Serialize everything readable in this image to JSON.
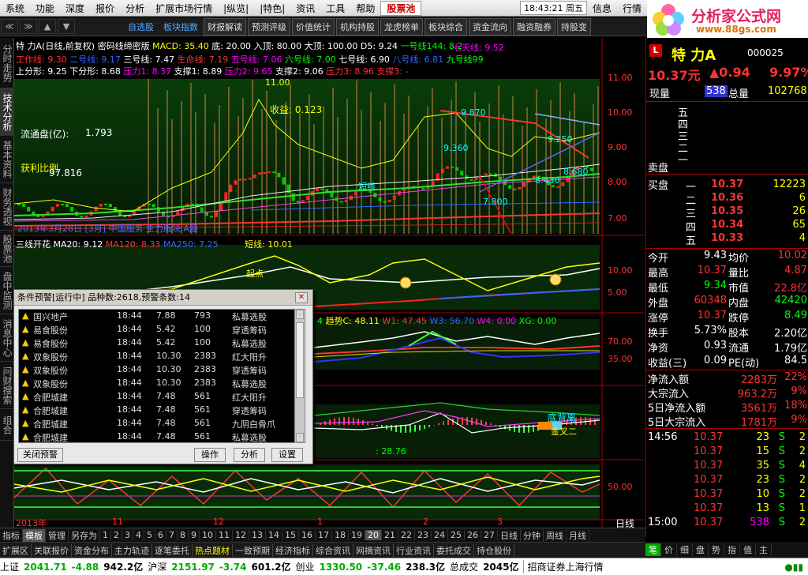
{
  "menubar": {
    "items": [
      "系统",
      "功能",
      "深度",
      "报价",
      "分析",
      "扩展市场行情",
      "|纵览|",
      "|特色|",
      "资讯",
      "工具",
      "帮助"
    ],
    "highlight": "股票池",
    "time": "18:43:21",
    "weekday": "周五",
    "right": [
      "信息",
      "行情"
    ]
  },
  "logo": {
    "title": "分析家公式网",
    "site": "www.88gs.com"
  },
  "toolbar": {
    "items": [
      "自选股",
      "板块指数",
      "财报解读",
      "预测评级",
      "价值统计",
      "机构持股",
      "龙虎榜单",
      "板块综合",
      "资金流向",
      "融资融券",
      "持股变"
    ]
  },
  "left_tabs": [
    "分时走势",
    "技术分析",
    "基本资料",
    "财务透视",
    "股票池",
    "盘中监测",
    "消息中心",
    "问财搜索",
    "组合"
  ],
  "main_info": {
    "stock": "特 力A(日线,前复权)",
    "formula": "密码线缔密版",
    "macd": "MACD: 35.40",
    "di": "底: 20.00",
    "ruding": "入顶: 80.00",
    "dading": "大顶: 100.00",
    "d5": "D5: 9.24",
    "yihao": "一号线144: 8.2",
    "line2": [
      "工作线: 9.30",
      "二号线: 9.17",
      "三号线: 7.47",
      "生命线: 7.19",
      "五号线: 7.06",
      "六号线: 7.00",
      "七号线: 6.90",
      "八号线: 6.81",
      "九号线99"
    ],
    "qitian": "七天线: 9.52",
    "line3": [
      "上分形: 9.25",
      "下分形: 8.68",
      "压力1: 8.37",
      "支撑1: 8.89",
      "压力2: 9.65",
      "支撑2: 9.06",
      "压力3: 8.96",
      "支撑3: -"
    ],
    "liutongpan": "流通盘(亿):",
    "liutong_val": "1.793",
    "huoli": "获利比例",
    "huoli_val": "97.816",
    "shouyi": "收益: 0.123",
    "price_labels": [
      "11.00",
      "10.00",
      "9.00",
      "8.00",
      "7.00"
    ],
    "annot": [
      "11.00",
      "9.870",
      "9.360",
      "9.250",
      "8.680",
      "8.430",
      "7.800",
      "短线"
    ],
    "ticker_line": "2013年3月28日 [3月] 中国服务 主力版块 A股",
    "sub1_label": "三线开花",
    "ma20": "MA20: 9.12",
    "ma120": "MA120: 8.33",
    "ma250": "MA250: 7.25",
    "duanxian": "短线: 10.01",
    "sub2_labels": [
      "10.00",
      "5.00"
    ],
    "qidian": "起点",
    "trend": "趋势C: 48.11",
    "w1": "W1: 47.45",
    "w3": "W3: 56.70",
    "w4": "W4: 0.00",
    "xg": "XG: 0.00",
    "sub3_labels": [
      "70.00",
      "35.00"
    ],
    "sub4_labels": [
      "底背离",
      "金叉二"
    ],
    "sub4_val": ": 28.76",
    "sub5_labels": [
      "50.00"
    ],
    "xaxis": [
      "2013年",
      "11",
      "12",
      "1",
      "2",
      "3"
    ],
    "dayline": "日线"
  },
  "dialog": {
    "title": "条件预警[运行中] 品种数:2618,预警条数:14",
    "rows": [
      [
        "国兴地产",
        "18:44",
        "7.88",
        "793",
        "私募选股"
      ],
      [
        "易食股份",
        "18:44",
        "5.42",
        "100",
        "穿透筹码"
      ],
      [
        "易食股份",
        "18:44",
        "5.42",
        "100",
        "私募选股"
      ],
      [
        "双象股份",
        "18:44",
        "10.30",
        "2383",
        "红大阳升"
      ],
      [
        "双象股份",
        "18:44",
        "10.30",
        "2383",
        "穿透筹码"
      ],
      [
        "双象股份",
        "18:44",
        "10.30",
        "2383",
        "私募选股"
      ],
      [
        "合肥城建",
        "18:44",
        "7.48",
        "561",
        "红大阳升"
      ],
      [
        "合肥城建",
        "18:44",
        "7.48",
        "561",
        "穿透筹码"
      ],
      [
        "合肥城建",
        "18:44",
        "7.48",
        "561",
        "九阴白骨爪"
      ],
      [
        "合肥城建",
        "18:44",
        "7.48",
        "561",
        "私募选股"
      ]
    ],
    "btn_close": "关闭预警",
    "btn_op": "操作",
    "btn_an": "分析",
    "btn_set": "设置"
  },
  "quote": {
    "badge": "L",
    "name": "特  力A",
    "code": "000025",
    "price": "10.37元",
    "change": "▲0.94",
    "pct": "9.97%",
    "xianliang_lbl": "现量",
    "xianliang": "538",
    "zongliang_lbl": "总量",
    "zongliang": "102768",
    "sell": [
      "五",
      "四",
      "三",
      "二",
      "一"
    ],
    "sell_lbl": "卖盘",
    "buy_lbl": "买盘",
    "buy": [
      [
        "一",
        "10.37",
        "12223"
      ],
      [
        "二",
        "10.36",
        "6"
      ],
      [
        "三",
        "10.35",
        "26"
      ],
      [
        "四",
        "10.34",
        "65"
      ],
      [
        "五",
        "10.33",
        "4"
      ]
    ],
    "stats": [
      [
        "今开",
        "9.43",
        "均价",
        "10.02"
      ],
      [
        "最高",
        "10.37",
        "量比",
        "4.87"
      ],
      [
        "最低",
        "9.34",
        "市值",
        "22.8亿"
      ],
      [
        "外盘",
        "60348",
        "内盘",
        "42420"
      ],
      [
        "涨停",
        "10.37",
        "跌停",
        "8.49"
      ],
      [
        "换手",
        "5.73%",
        "股本",
        "2.20亿"
      ],
      [
        "净资",
        "0.93",
        "流通",
        "1.79亿"
      ],
      [
        "收益(三)",
        "0.09",
        "PE(动)",
        "84.5"
      ]
    ],
    "flows": [
      [
        "净流入额",
        "2283万",
        "22%"
      ],
      [
        "大宗流入",
        "963.2万",
        "9%"
      ],
      [
        "5日净流入额",
        "3561万",
        "18%"
      ],
      [
        "5日大宗流入",
        "1781万",
        "9%"
      ]
    ],
    "ticks": [
      [
        "14:56",
        "10.37",
        "23",
        "S",
        "2"
      ],
      [
        "",
        "10.37",
        "15",
        "S",
        "2"
      ],
      [
        "",
        "10.37",
        "35",
        "S",
        "4"
      ],
      [
        "",
        "10.37",
        "23",
        "S",
        "2"
      ],
      [
        "",
        "10.37",
        "10",
        "S",
        "2"
      ],
      [
        "",
        "10.37",
        "13",
        "S",
        "1"
      ],
      [
        "15:00",
        "10.37",
        "538",
        "S",
        "2"
      ]
    ]
  },
  "bottom_tabs": [
    "指标",
    "模板",
    "管理",
    "另存为",
    "1",
    "2",
    "3",
    "4",
    "5",
    "6",
    "7",
    "8",
    "9",
    "10",
    "11",
    "12",
    "13",
    "14",
    "15",
    "16",
    "17",
    "18",
    "19",
    "20",
    "21",
    "22",
    "23",
    "24",
    "25",
    "26",
    "27",
    "日线",
    "分钟",
    "周线",
    "月线"
  ],
  "func_bar": [
    "扩展区",
    "关联报价",
    "资金分布",
    "主力轨迹",
    "逐笔委托",
    "热点题材",
    "一致预期",
    "经济指标",
    "综合资讯",
    "网摘资讯",
    "行业资讯",
    "委托成交",
    "持仓股份"
  ],
  "right_tabs": [
    "笔",
    "价",
    "细",
    "盘",
    "势",
    "指",
    "值",
    "主"
  ],
  "status": {
    "sh_lbl": "上证",
    "sh": "2041.71",
    "sh_ch": "-4.88",
    "sh_amt": "942.2亿",
    "hs_lbl": "沪深",
    "hs": "2151.97",
    "hs_ch": "-3.74",
    "hs_amt": "601.2亿",
    "cy_lbl": "创业",
    "cy": "1330.50",
    "cy_ch": "-37.46",
    "cy_amt": "238.3亿",
    "total_lbl": "总成交",
    "total": "2045亿",
    "broker": "招商证券上海行情"
  },
  "colors": {
    "up": "#ff3333",
    "down": "#00ff00",
    "accent": "#ffff00"
  }
}
